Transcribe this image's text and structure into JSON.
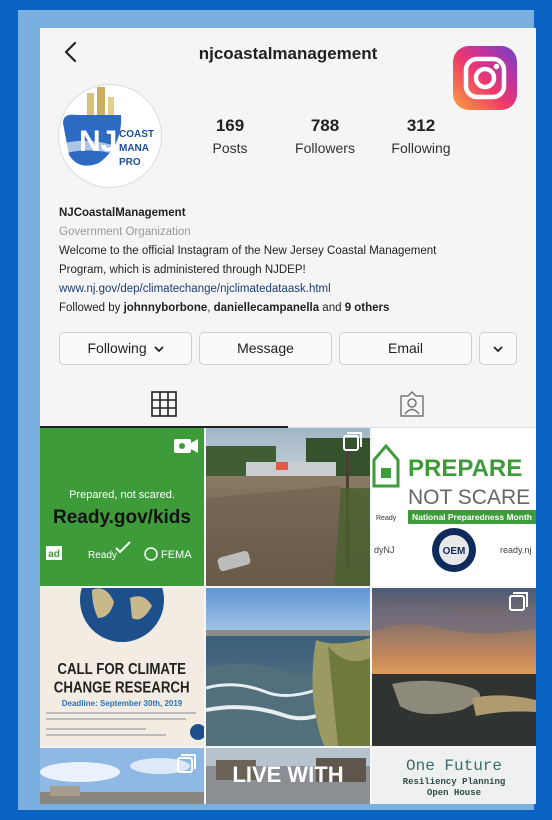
{
  "profile": {
    "username": "njcoastalmanagement",
    "avatar_text": [
      "COAST",
      "MANA",
      "PRO"
    ],
    "stats": [
      {
        "value": "169",
        "label": "Posts"
      },
      {
        "value": "788",
        "label": "Followers"
      },
      {
        "value": "312",
        "label": "Following"
      }
    ],
    "display_name": "NJCoastalManagement",
    "category": "Government Organization",
    "bio_line1": "Welcome to the official Instagram of the New Jersey Coastal Management",
    "bio_line2": "Program, which is administered through NJDEP!",
    "link": "www.nj.gov/dep/climatechange/njclimatedataask.html",
    "followed_by_prefix": "Followed by ",
    "followed_by_user1": "johnnyborbone",
    "followed_by_sep": ", ",
    "followed_by_user2": "daniellecampanella",
    "followed_by_and": " and ",
    "followed_by_others": "9 others"
  },
  "buttons": {
    "following": "Following",
    "message": "Message",
    "email": "Email"
  },
  "icons": {
    "back": "chevron-left-icon",
    "instagram": "instagram-logo-icon",
    "dropdown": "chevron-down-icon",
    "grid": "grid-icon",
    "tagged": "tagged-person-icon",
    "video": "video-camera-icon",
    "carousel": "multiple-posts-icon"
  },
  "posts": {
    "p1": {
      "line1": "Prepared, not scared.",
      "line2": "Ready.gov/kids",
      "ad": "ad",
      "ready": "Ready",
      "fema": "FEMA"
    },
    "p3": {
      "title1": "PREPARE",
      "title2": "NOT SCARE",
      "ready": "Ready",
      "banner": "National Preparedness Month",
      "left": "dyNJ",
      "seal": "OEM",
      "right": "ready.nj"
    },
    "p4": {
      "title1": "CALL FOR CLIMATE",
      "title2": "CHANGE RESEARCH",
      "deadline": "Deadline: September 30th, 2019"
    },
    "p8": {
      "text": "LIVE WITH"
    },
    "p9": {
      "title": "One Future",
      "sub1": "Resiliency Planning",
      "sub2": "Open House"
    }
  },
  "colors": {
    "background": "#0b63c4",
    "frame": "#7ab0df",
    "ready_green": "#3e9b3a"
  }
}
